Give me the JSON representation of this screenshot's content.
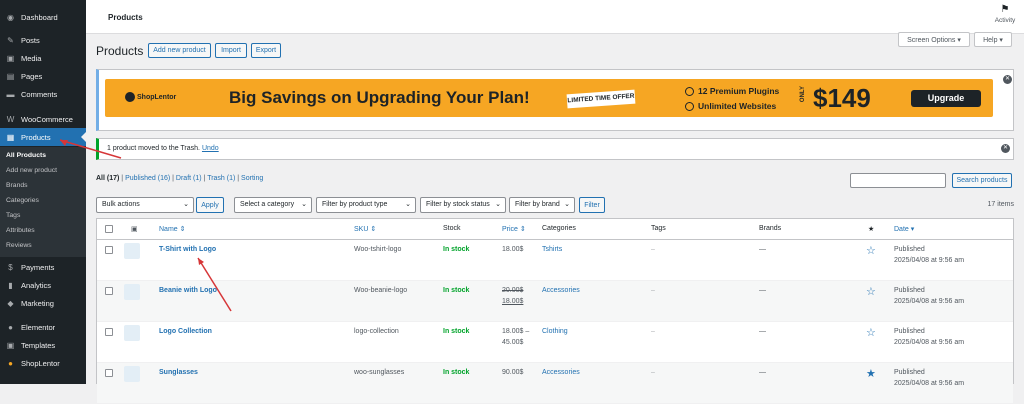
{
  "sidebar": {
    "items": [
      {
        "label": "Dashboard",
        "icon": "dashboard-icon"
      },
      {
        "label": "Posts",
        "icon": "pin-icon"
      },
      {
        "label": "Media",
        "icon": "media-icon"
      },
      {
        "label": "Pages",
        "icon": "pages-icon"
      },
      {
        "label": "Comments",
        "icon": "comments-icon"
      },
      {
        "label": "WooCommerce",
        "icon": "woocommerce-icon"
      },
      {
        "label": "Products",
        "icon": "products-icon"
      },
      {
        "label": "Payments",
        "icon": "payments-icon"
      },
      {
        "label": "Analytics",
        "icon": "analytics-icon"
      },
      {
        "label": "Marketing",
        "icon": "marketing-icon"
      },
      {
        "label": "Elementor",
        "icon": "elementor-icon"
      },
      {
        "label": "Templates",
        "icon": "templates-icon"
      },
      {
        "label": "ShopLentor",
        "icon": "shoplentor-icon"
      }
    ],
    "submenu": [
      "All Products",
      "Add new product",
      "Brands",
      "Categories",
      "Tags",
      "Attributes",
      "Reviews"
    ]
  },
  "topbar": {
    "title": "Products",
    "activity": "Activity"
  },
  "header": {
    "page_title": "Products",
    "add_new": "Add new product",
    "import": "Import",
    "export": "Export",
    "screen_options": "Screen Options ▾",
    "help": "Help ▾"
  },
  "promo": {
    "logo": "ShopLentor",
    "headline": "Big Savings on Upgrading Your Plan!",
    "offer": "LIMITED TIME OFFER",
    "feature1": "12 Premium Plugins",
    "feature2": "Unlimited Websites",
    "only": "ONLY",
    "price": "$149",
    "button": "Upgrade"
  },
  "notice": {
    "text": "1 product moved to the Trash.",
    "undo": "Undo"
  },
  "status_links": {
    "all": "All (17)",
    "published": "Published (16)",
    "draft": "Draft (1)",
    "trash": "Trash (1)",
    "sorting": "Sorting"
  },
  "search": {
    "button": "Search products",
    "value": ""
  },
  "filters": {
    "bulk_actions": "Bulk actions",
    "apply": "Apply",
    "category": "Select a category",
    "product_type": "Filter by product type",
    "stock_status": "Filter by stock status",
    "brand": "Filter by brand",
    "filter": "Filter",
    "count": "17 items"
  },
  "table": {
    "headers": {
      "name": "Name ⇕",
      "sku": "SKU ⇕",
      "stock": "Stock",
      "price": "Price ⇕",
      "categories": "Categories",
      "tags": "Tags",
      "brands": "Brands",
      "featured": "★",
      "date": "Date ▾"
    },
    "rows": [
      {
        "name": "T-Shirt with Logo",
        "sku": "Woo-tshirt-logo",
        "stock": "In stock",
        "price": "18.00$",
        "price_old": "",
        "category": "Tshirts",
        "tags": "–",
        "brands": "—",
        "featured": "☆",
        "date1": "Published",
        "date2": "2025/04/08 at 9:56 am"
      },
      {
        "name": "Beanie with Logo",
        "sku": "Woo-beanie-logo",
        "stock": "In stock",
        "price": "18.00$",
        "price_old": "20.00$",
        "category": "Accessories",
        "tags": "–",
        "brands": "—",
        "featured": "☆",
        "date1": "Published",
        "date2": "2025/04/08 at 9:56 am"
      },
      {
        "name": "Logo Collection",
        "sku": "logo-collection",
        "stock": "In stock",
        "price": "18.00$ –",
        "price_old": "45.00$",
        "category": "Clothing",
        "tags": "–",
        "brands": "—",
        "featured": "☆",
        "date1": "Published",
        "date2": "2025/04/08 at 9:56 am"
      },
      {
        "name": "Sunglasses",
        "sku": "woo-sunglasses",
        "stock": "In stock",
        "price": "90.00$",
        "price_old": "",
        "category": "Accessories",
        "tags": "–",
        "brands": "—",
        "featured": "★",
        "date1": "Published",
        "date2": "2025/04/08 at 9:56 am"
      }
    ]
  },
  "colors": {
    "accent": "#2271b1",
    "sidebar": "#1d2327",
    "in_stock": "#00a32a",
    "annotation_arrow": "#d63638",
    "banner": "#f6a623"
  }
}
